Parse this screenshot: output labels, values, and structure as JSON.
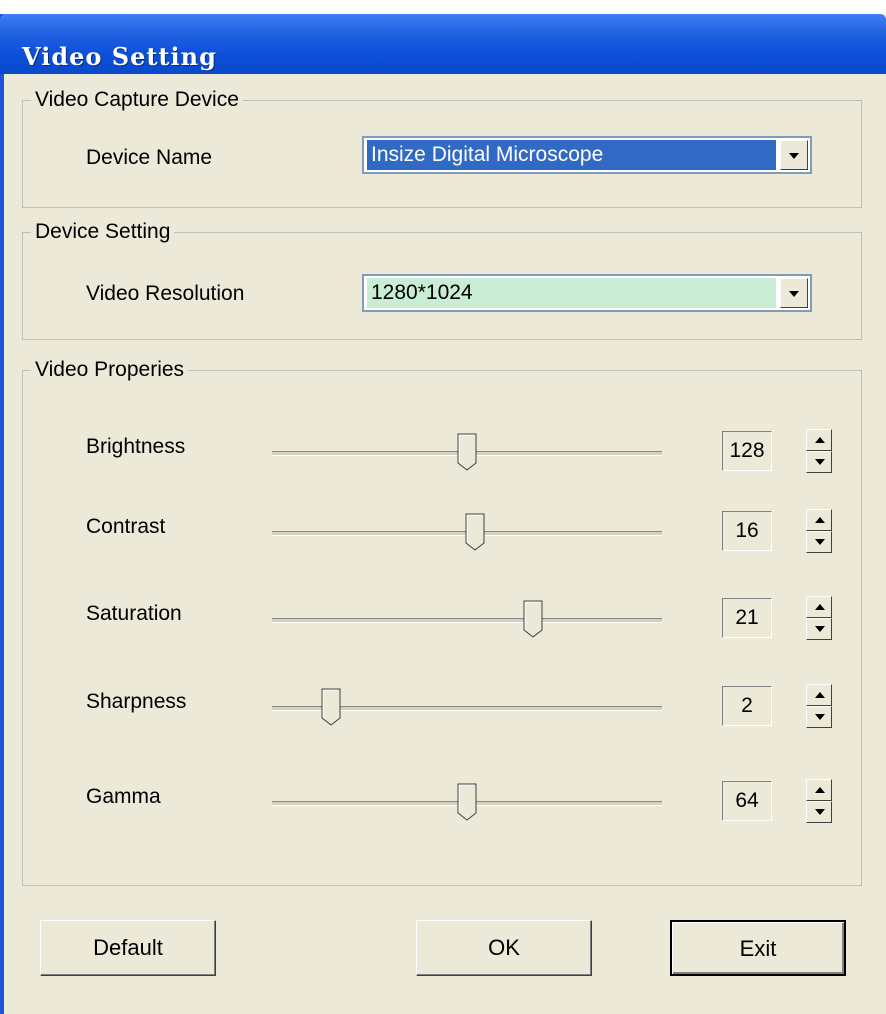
{
  "window": {
    "title": "Video Setting"
  },
  "capture_device": {
    "legend": "Video Capture Device",
    "device_label": "Device Name",
    "device_value": "Insize Digital Microscope"
  },
  "device_setting": {
    "legend": "Device Setting",
    "resolution_label": "Video Resolution",
    "resolution_value": "1280*1024"
  },
  "properties": {
    "legend": "Video Properies",
    "items": [
      {
        "label": "Brightness",
        "value": "128",
        "level": 0.5
      },
      {
        "label": "Contrast",
        "value": "16",
        "level": 0.52
      },
      {
        "label": "Saturation",
        "value": "21",
        "level": 0.67
      },
      {
        "label": "Sharpness",
        "value": "2",
        "level": 0.15
      },
      {
        "label": "Gamma",
        "value": "64",
        "level": 0.5
      }
    ]
  },
  "buttons": {
    "default": "Default",
    "ok": "OK",
    "exit": "Exit"
  },
  "colors": {
    "title_bar": "#0b4fd9",
    "selection": "#316ac5",
    "resolution_bg": "#c8ecd4",
    "dialog_bg": "#ece9d8"
  }
}
